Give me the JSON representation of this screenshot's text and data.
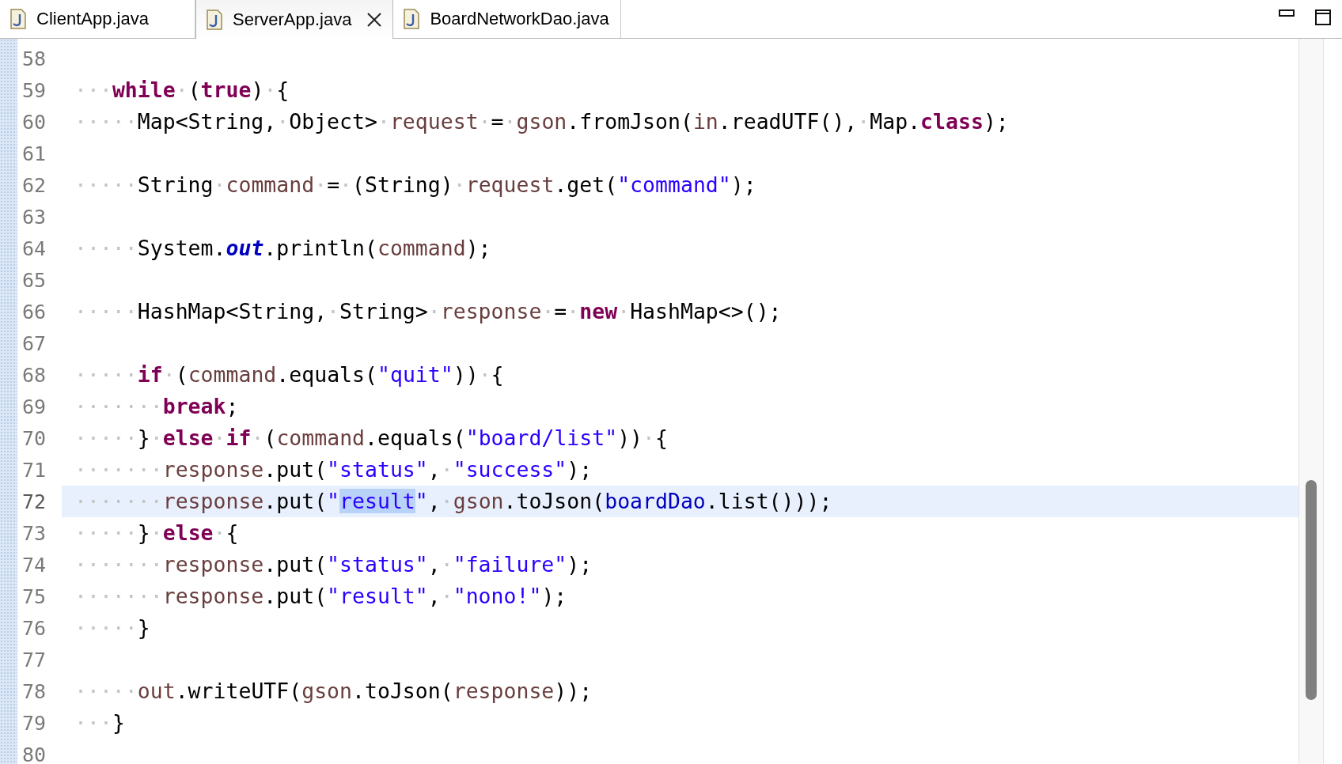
{
  "tabs": [
    {
      "label": "ClientApp.java",
      "selected": false
    },
    {
      "label": "ServerApp.java",
      "selected": true
    },
    {
      "label": "BoardNetworkDao.java",
      "selected": false
    }
  ],
  "lines": [
    {
      "number": "58",
      "current": false
    },
    {
      "number": "59",
      "current": false,
      "tokens": [
        {
          "kind": "ws",
          "text": "···"
        },
        {
          "kind": "kw",
          "text": "while"
        },
        {
          "kind": "ws",
          "text": "·"
        },
        {
          "kind": "plain",
          "text": "("
        },
        {
          "kind": "kw",
          "text": "true"
        },
        {
          "kind": "plain",
          "text": ")"
        },
        {
          "kind": "ws",
          "text": "·"
        },
        {
          "kind": "plain",
          "text": "{"
        }
      ]
    },
    {
      "number": "60",
      "current": false,
      "tokens": [
        {
          "kind": "ws",
          "text": "·····"
        },
        {
          "kind": "plain",
          "text": "Map<String,"
        },
        {
          "kind": "ws",
          "text": "·"
        },
        {
          "kind": "plain",
          "text": "Object>"
        },
        {
          "kind": "ws",
          "text": "·"
        },
        {
          "kind": "local",
          "text": "request"
        },
        {
          "kind": "ws",
          "text": "·"
        },
        {
          "kind": "plain",
          "text": "="
        },
        {
          "kind": "ws",
          "text": "·"
        },
        {
          "kind": "local",
          "text": "gson"
        },
        {
          "kind": "plain",
          "text": ".fromJson("
        },
        {
          "kind": "local",
          "text": "in"
        },
        {
          "kind": "plain",
          "text": ".readUTF(),"
        },
        {
          "kind": "ws",
          "text": "·"
        },
        {
          "kind": "plain",
          "text": "Map."
        },
        {
          "kind": "kw",
          "text": "class"
        },
        {
          "kind": "plain",
          "text": ");"
        }
      ]
    },
    {
      "number": "61",
      "current": false
    },
    {
      "number": "62",
      "current": false,
      "tokens": [
        {
          "kind": "ws",
          "text": "·····"
        },
        {
          "kind": "plain",
          "text": "String"
        },
        {
          "kind": "ws",
          "text": "·"
        },
        {
          "kind": "local",
          "text": "command"
        },
        {
          "kind": "ws",
          "text": "·"
        },
        {
          "kind": "plain",
          "text": "="
        },
        {
          "kind": "ws",
          "text": "·"
        },
        {
          "kind": "plain",
          "text": "(String)"
        },
        {
          "kind": "ws",
          "text": "·"
        },
        {
          "kind": "local",
          "text": "request"
        },
        {
          "kind": "plain",
          "text": ".get("
        },
        {
          "kind": "str",
          "text": "\"command\""
        },
        {
          "kind": "plain",
          "text": ");"
        }
      ]
    },
    {
      "number": "63",
      "current": false
    },
    {
      "number": "64",
      "current": false,
      "tokens": [
        {
          "kind": "ws",
          "text": "·····"
        },
        {
          "kind": "plain",
          "text": "System."
        },
        {
          "kind": "static",
          "text": "out"
        },
        {
          "kind": "plain",
          "text": ".println("
        },
        {
          "kind": "local",
          "text": "command"
        },
        {
          "kind": "plain",
          "text": ");"
        }
      ]
    },
    {
      "number": "65",
      "current": false
    },
    {
      "number": "66",
      "current": false,
      "tokens": [
        {
          "kind": "ws",
          "text": "·····"
        },
        {
          "kind": "plain",
          "text": "HashMap<String,"
        },
        {
          "kind": "ws",
          "text": "·"
        },
        {
          "kind": "plain",
          "text": "String>"
        },
        {
          "kind": "ws",
          "text": "·"
        },
        {
          "kind": "local",
          "text": "response"
        },
        {
          "kind": "ws",
          "text": "·"
        },
        {
          "kind": "plain",
          "text": "="
        },
        {
          "kind": "ws",
          "text": "·"
        },
        {
          "kind": "kw",
          "text": "new"
        },
        {
          "kind": "ws",
          "text": "·"
        },
        {
          "kind": "plain",
          "text": "HashMap<>();"
        }
      ]
    },
    {
      "number": "67",
      "current": false
    },
    {
      "number": "68",
      "current": false,
      "tokens": [
        {
          "kind": "ws",
          "text": "·····"
        },
        {
          "kind": "kw",
          "text": "if"
        },
        {
          "kind": "ws",
          "text": "·"
        },
        {
          "kind": "plain",
          "text": "("
        },
        {
          "kind": "local",
          "text": "command"
        },
        {
          "kind": "plain",
          "text": ".equals("
        },
        {
          "kind": "str",
          "text": "\"quit\""
        },
        {
          "kind": "plain",
          "text": "))"
        },
        {
          "kind": "ws",
          "text": "·"
        },
        {
          "kind": "plain",
          "text": "{"
        }
      ]
    },
    {
      "number": "69",
      "current": false,
      "tokens": [
        {
          "kind": "ws",
          "text": "·······"
        },
        {
          "kind": "kw",
          "text": "break"
        },
        {
          "kind": "plain",
          "text": ";"
        }
      ]
    },
    {
      "number": "70",
      "current": false,
      "tokens": [
        {
          "kind": "ws",
          "text": "·····"
        },
        {
          "kind": "plain",
          "text": "}"
        },
        {
          "kind": "ws",
          "text": "·"
        },
        {
          "kind": "kw",
          "text": "else"
        },
        {
          "kind": "ws",
          "text": "·"
        },
        {
          "kind": "kw",
          "text": "if"
        },
        {
          "kind": "ws",
          "text": "·"
        },
        {
          "kind": "plain",
          "text": "("
        },
        {
          "kind": "local",
          "text": "command"
        },
        {
          "kind": "plain",
          "text": ".equals("
        },
        {
          "kind": "str",
          "text": "\"board/list\""
        },
        {
          "kind": "plain",
          "text": "))"
        },
        {
          "kind": "ws",
          "text": "·"
        },
        {
          "kind": "plain",
          "text": "{"
        }
      ]
    },
    {
      "number": "71",
      "current": false,
      "tokens": [
        {
          "kind": "ws",
          "text": "·······"
        },
        {
          "kind": "local",
          "text": "response"
        },
        {
          "kind": "plain",
          "text": ".put("
        },
        {
          "kind": "str",
          "text": "\"status\""
        },
        {
          "kind": "plain",
          "text": ","
        },
        {
          "kind": "ws",
          "text": "·"
        },
        {
          "kind": "str",
          "text": "\"success\""
        },
        {
          "kind": "plain",
          "text": ");"
        }
      ]
    },
    {
      "number": "72",
      "current": true,
      "tokens": [
        {
          "kind": "ws",
          "text": "·······"
        },
        {
          "kind": "local",
          "text": "response"
        },
        {
          "kind": "plain",
          "text": ".put("
        },
        {
          "kind": "str",
          "text": "\""
        },
        {
          "kind": "mark",
          "text": "result"
        },
        {
          "kind": "str",
          "text": "\""
        },
        {
          "kind": "plain",
          "text": ","
        },
        {
          "kind": "ws",
          "text": "·"
        },
        {
          "kind": "local",
          "text": "gson"
        },
        {
          "kind": "plain",
          "text": ".toJson("
        },
        {
          "kind": "field",
          "text": "boardDao"
        },
        {
          "kind": "plain",
          "text": ".list()));"
        }
      ]
    },
    {
      "number": "73",
      "current": false,
      "tokens": [
        {
          "kind": "ws",
          "text": "·····"
        },
        {
          "kind": "plain",
          "text": "}"
        },
        {
          "kind": "ws",
          "text": "·"
        },
        {
          "kind": "kw",
          "text": "else"
        },
        {
          "kind": "ws",
          "text": "·"
        },
        {
          "kind": "plain",
          "text": "{"
        }
      ]
    },
    {
      "number": "74",
      "current": false,
      "tokens": [
        {
          "kind": "ws",
          "text": "·······"
        },
        {
          "kind": "local",
          "text": "response"
        },
        {
          "kind": "plain",
          "text": ".put("
        },
        {
          "kind": "str",
          "text": "\"status\""
        },
        {
          "kind": "plain",
          "text": ","
        },
        {
          "kind": "ws",
          "text": "·"
        },
        {
          "kind": "str",
          "text": "\"failure\""
        },
        {
          "kind": "plain",
          "text": ");"
        }
      ]
    },
    {
      "number": "75",
      "current": false,
      "tokens": [
        {
          "kind": "ws",
          "text": "·······"
        },
        {
          "kind": "local",
          "text": "response"
        },
        {
          "kind": "plain",
          "text": ".put("
        },
        {
          "kind": "str",
          "text": "\"result\""
        },
        {
          "kind": "plain",
          "text": ","
        },
        {
          "kind": "ws",
          "text": "·"
        },
        {
          "kind": "str",
          "text": "\"nono!\""
        },
        {
          "kind": "plain",
          "text": ");"
        }
      ]
    },
    {
      "number": "76",
      "current": false,
      "tokens": [
        {
          "kind": "ws",
          "text": "·····"
        },
        {
          "kind": "plain",
          "text": "}"
        }
      ]
    },
    {
      "number": "77",
      "current": false
    },
    {
      "number": "78",
      "current": false,
      "tokens": [
        {
          "kind": "ws",
          "text": "·····"
        },
        {
          "kind": "local",
          "text": "out"
        },
        {
          "kind": "plain",
          "text": ".writeUTF("
        },
        {
          "kind": "local",
          "text": "gson"
        },
        {
          "kind": "plain",
          "text": ".toJson("
        },
        {
          "kind": "local",
          "text": "response"
        },
        {
          "kind": "plain",
          "text": "));"
        }
      ]
    },
    {
      "number": "79",
      "current": false,
      "tokens": [
        {
          "kind": "ws",
          "text": "···"
        },
        {
          "kind": "plain",
          "text": "}"
        }
      ]
    },
    {
      "number": "80",
      "current": false
    }
  ]
}
